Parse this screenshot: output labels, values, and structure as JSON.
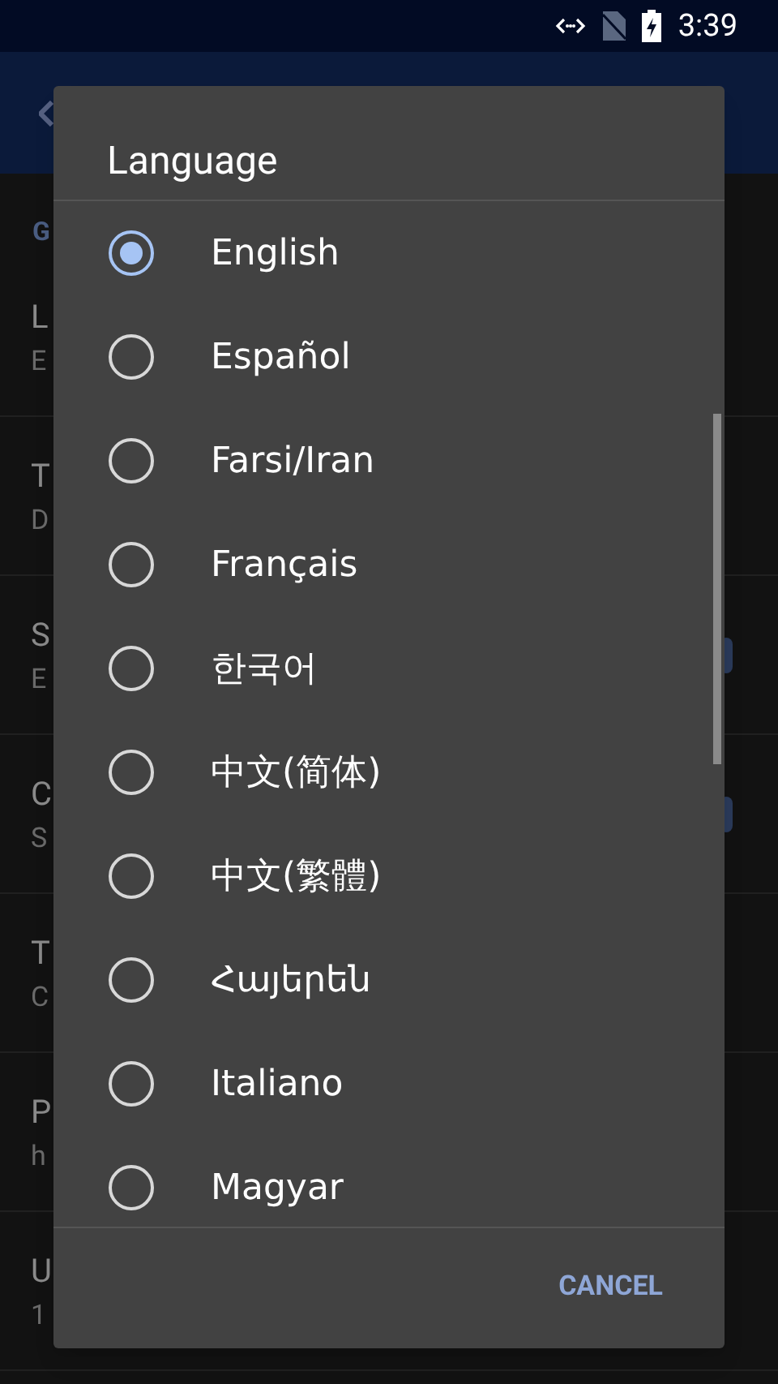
{
  "status_bar": {
    "time": "3:39"
  },
  "settings": {
    "section_header": "G",
    "items": [
      {
        "title": "L",
        "subtitle": "E",
        "kind": "text"
      },
      {
        "title": "T",
        "subtitle": "D",
        "kind": "text"
      },
      {
        "title": "S",
        "subtitle": "E",
        "kind": "switch",
        "on": true
      },
      {
        "title": "C",
        "subtitle": "S",
        "kind": "switch",
        "on": true
      },
      {
        "title": "T",
        "subtitle": "C",
        "kind": "text"
      },
      {
        "title": "P",
        "subtitle": "h",
        "kind": "text"
      },
      {
        "title": "U",
        "subtitle": "1",
        "kind": "text"
      }
    ]
  },
  "dialog": {
    "title": "Language",
    "options": [
      {
        "label": "English",
        "selected": true
      },
      {
        "label": "Español",
        "selected": false
      },
      {
        "label": "Farsi/Iran",
        "selected": false
      },
      {
        "label": "Français",
        "selected": false
      },
      {
        "label": "한국어",
        "selected": false
      },
      {
        "label": "中文(简体)",
        "selected": false
      },
      {
        "label": "中文(繁體)",
        "selected": false
      },
      {
        "label": "Հայերեն",
        "selected": false
      },
      {
        "label": "Italiano",
        "selected": false
      },
      {
        "label": "Magyar",
        "selected": false
      }
    ],
    "buttons": [
      "CANCEL"
    ]
  }
}
